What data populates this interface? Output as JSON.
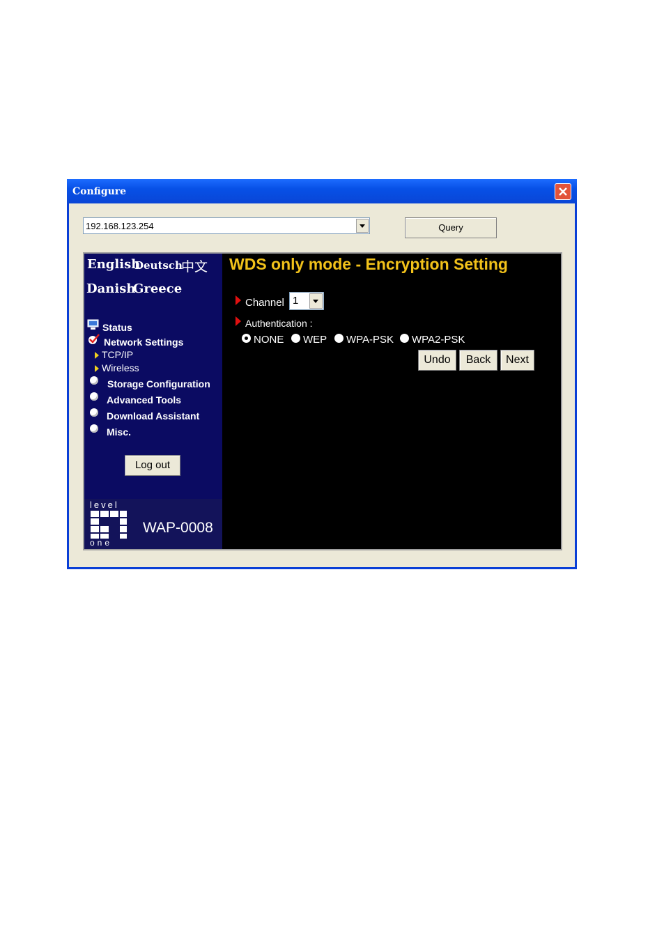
{
  "window": {
    "title": "Configure",
    "titlebar_color": "#0a46d6",
    "close_icon": "close-icon"
  },
  "toolbar": {
    "address_value": "192.168.123.254",
    "query_label": "Query"
  },
  "sidebar": {
    "languages_row1": [
      "English",
      "Deutsch",
      "中文"
    ],
    "languages_row2": [
      "Danish",
      "Greece"
    ],
    "menu": [
      {
        "label": "Status",
        "icon": "monitor-icon"
      },
      {
        "label": "Network Settings",
        "icon": "checkmark-icon"
      },
      {
        "label": "TCP/IP",
        "icon": "arrow-right-icon"
      },
      {
        "label": "Wireless",
        "icon": "arrow-right-icon"
      },
      {
        "label": "Storage Configuration",
        "icon": "bullet-icon"
      },
      {
        "label": "Advanced Tools",
        "icon": "bullet-icon"
      },
      {
        "label": "Download Assistant",
        "icon": "bullet-icon"
      },
      {
        "label": "Misc.",
        "icon": "bullet-icon"
      }
    ],
    "logout_label": "Log out",
    "brand": {
      "top": "level",
      "bottom": "one",
      "model": "WAP-0008"
    }
  },
  "main": {
    "title": "WDS only mode - Encryption Setting",
    "title_color": "#f2c21a",
    "channel_label": "Channel",
    "channel_value": "1",
    "auth_label": "Authentication :",
    "auth_options": [
      "NONE",
      "WEP",
      "WPA-PSK",
      "WPA2-PSK"
    ],
    "auth_selected": "NONE",
    "buttons": {
      "undo": "Undo",
      "back": "Back",
      "next": "Next"
    }
  }
}
